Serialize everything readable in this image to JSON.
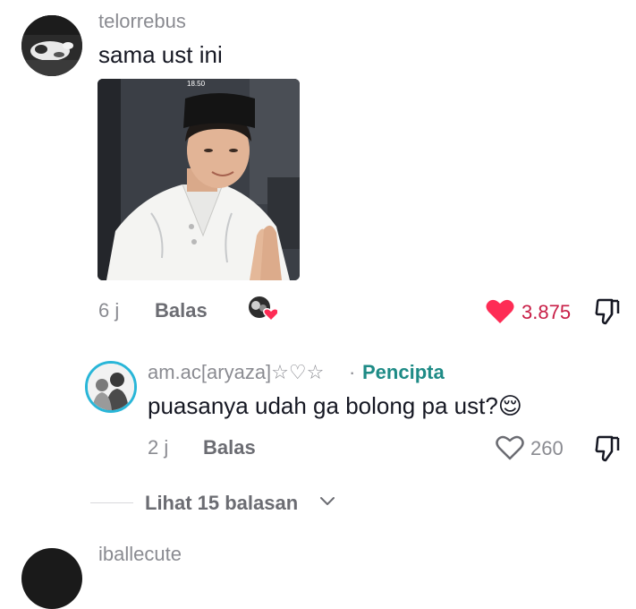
{
  "comment": {
    "username": "telorrebus",
    "text": "sama ust ini",
    "photo_timestamp": "18.50",
    "time": "6 j",
    "reply_label": "Balas",
    "likes": "3.875",
    "like_color": "#fe2c55"
  },
  "reply": {
    "username": "am.ac[aryaza]☆♡☆",
    "separator": "·",
    "creator_label": "Pencipta",
    "text": "puasanya udah ga bolong pa ust?😌",
    "time": "2 j",
    "reply_label": "Balas",
    "likes": "260"
  },
  "view_replies": {
    "label": "Lihat 15 balasan"
  },
  "next_comment": {
    "username": "iballecute"
  },
  "colors": {
    "creator_ring": "#29b6d8",
    "creator_text": "#1e8b86",
    "like_red": "#fe2c55"
  }
}
